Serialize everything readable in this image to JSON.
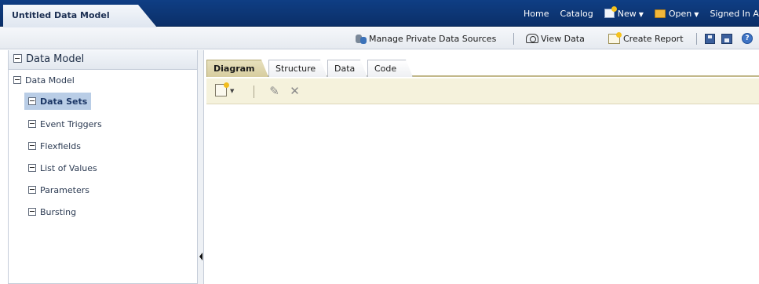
{
  "header": {
    "document_title": "Untitled Data Model",
    "links": {
      "home": "Home",
      "catalog": "Catalog",
      "new": "New",
      "open": "Open",
      "signed_in": "Signed In As"
    },
    "icons": [
      "new-icon",
      "open-icon"
    ]
  },
  "toolbar": {
    "manage_data_sources": "Manage Private Data Sources",
    "view_data": "View Data",
    "create_report": "Create Report",
    "help_glyph": "?"
  },
  "left_panel": {
    "title": "Data Model",
    "tree": {
      "root": "Data Model",
      "items": [
        {
          "label": "Data Sets",
          "selected": true
        },
        {
          "label": "Event Triggers",
          "selected": false
        },
        {
          "label": "Flexfields",
          "selected": false
        },
        {
          "label": "List of Values",
          "selected": false
        },
        {
          "label": "Parameters",
          "selected": false
        },
        {
          "label": "Bursting",
          "selected": false
        }
      ]
    }
  },
  "editor": {
    "tabs": [
      {
        "label": "Diagram",
        "active": true
      },
      {
        "label": "Structure",
        "active": false
      },
      {
        "label": "Data",
        "active": false
      },
      {
        "label": "Code",
        "active": false
      }
    ],
    "toolbar_glyphs": {
      "edit": "✎",
      "delete": "✕",
      "caret": "▼"
    }
  },
  "colors": {
    "header_bg": "#0f3e84",
    "selected_row": "#b9cde6",
    "active_tab": "#d7cd9f",
    "sub_toolbar_bg": "#f5f2dc"
  }
}
